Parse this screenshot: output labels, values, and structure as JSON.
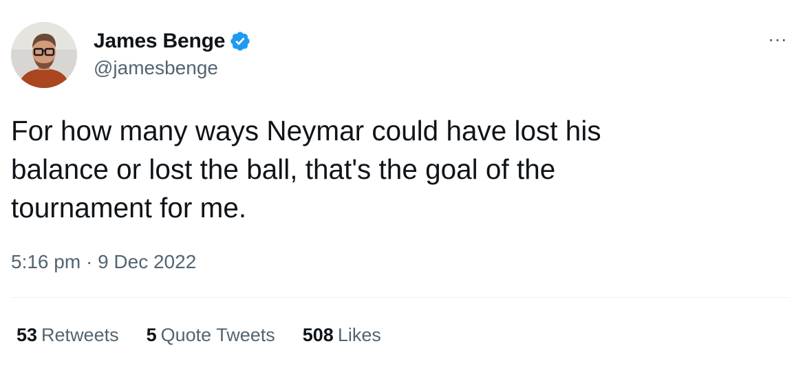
{
  "author": {
    "display_name": "James Benge",
    "handle": "@jamesbenge",
    "verified": true,
    "avatar": "profile-photo"
  },
  "tweet": {
    "text": "For how many ways Neymar could have lost his\nbalance or lost the ball, that's the goal of the\ntournament for me.",
    "time": "5:16 pm",
    "separator": "·",
    "date": "9 Dec 2022"
  },
  "stats": [
    {
      "count": "53",
      "label": "Retweets"
    },
    {
      "count": "5",
      "label": "Quote Tweets"
    },
    {
      "count": "508",
      "label": "Likes"
    }
  ],
  "more_menu": {
    "label": "···",
    "icon": "more-horizontal-icon"
  },
  "colors": {
    "text": "#0f1419",
    "secondary": "#536471",
    "verified": "#1d9bf0",
    "divider": "#eff3f4"
  }
}
